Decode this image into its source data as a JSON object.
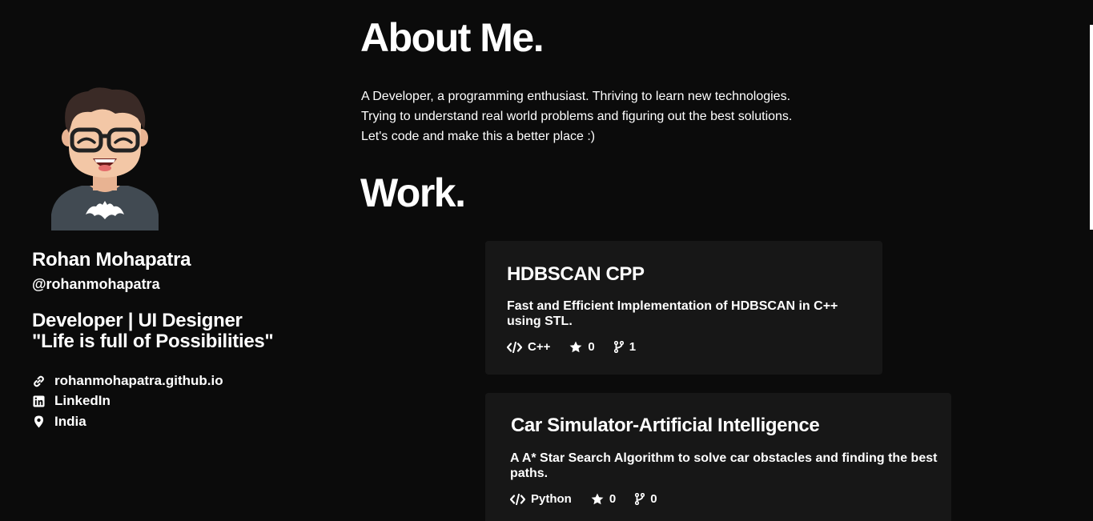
{
  "profile": {
    "name": "Rohan Mohapatra",
    "handle": "@rohanmohapatra",
    "bio_line1": "Developer | UI Designer",
    "bio_line2": "\"Life is full of Possibilities\"",
    "links": [
      {
        "icon": "link-icon",
        "label": "rohanmohapatra.github.io"
      },
      {
        "icon": "linkedin-icon",
        "label": "LinkedIn"
      },
      {
        "icon": "location-pin-icon",
        "label": "India"
      }
    ]
  },
  "about": {
    "heading": "About Me.",
    "lines": [
      "A Developer, a programming enthusiast. Thriving to learn new technologies.",
      "Trying to understand real world problems and figuring out the best solutions.",
      "Let's code and make this a better place :)"
    ]
  },
  "work": {
    "heading": "Work.",
    "projects": [
      {
        "title": "HDBSCAN CPP",
        "description": "Fast and Efficient Implementation of HDBSCAN in C++ using STL.",
        "language": "C++",
        "stars": "0",
        "forks": "1"
      },
      {
        "title": "Car Simulator-Artificial Intelligence",
        "description": "A A* Star Search Algorithm to solve car obstacles and finding the best paths.",
        "language": "Python",
        "stars": "0",
        "forks": "0"
      }
    ]
  },
  "colors": {
    "background": "#0b0b0b",
    "card": "#171717",
    "text": "#ffffff"
  }
}
